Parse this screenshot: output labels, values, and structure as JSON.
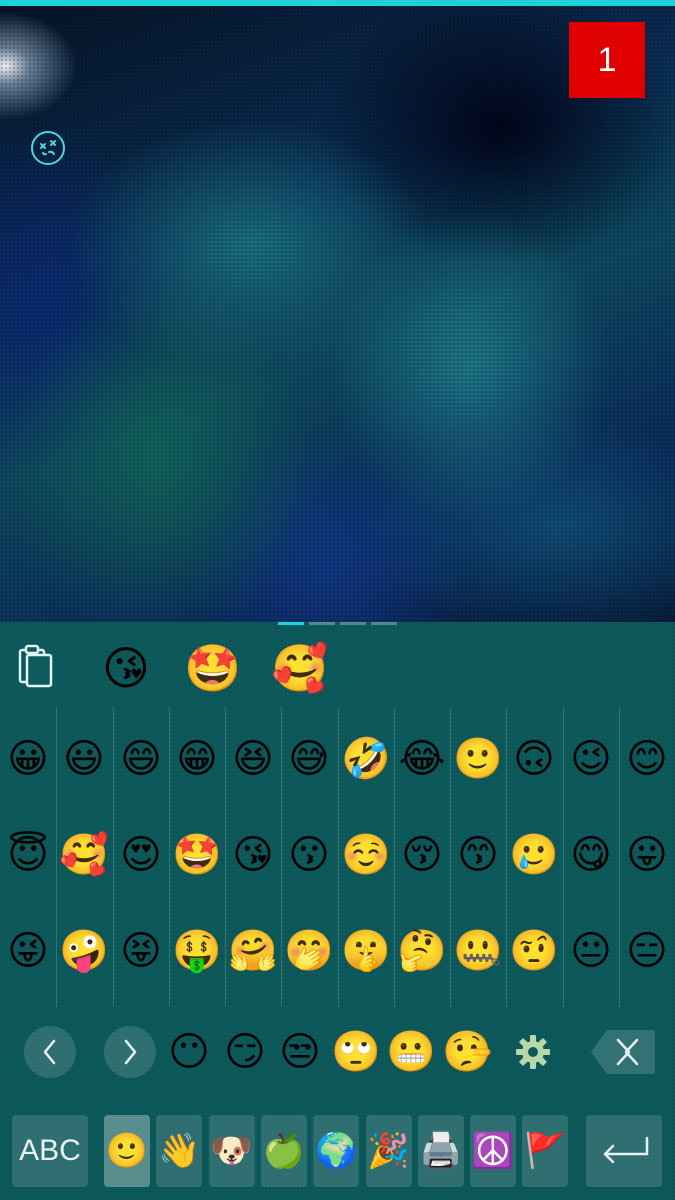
{
  "status": {
    "notification_count": "1"
  },
  "keyboard": {
    "recent_emojis": [
      "😘",
      "🤩",
      "🥰"
    ],
    "grid_rows": [
      [
        "😀",
        "😃",
        "😄",
        "😁",
        "😆",
        "😅",
        "🤣",
        "😂",
        "🙂",
        "🙃",
        "😉",
        "😊"
      ],
      [
        "😇",
        "🥰",
        "😍",
        "🤩",
        "😘",
        "😗",
        "☺️",
        "😚",
        "😙",
        "🥲",
        "😋",
        "😛"
      ],
      [
        "😜",
        "🤪",
        "😝",
        "🤑",
        "🤗",
        "🤭",
        "🤫",
        "🤔",
        "🤐",
        "🤨",
        "😐",
        "😑"
      ]
    ],
    "bottom_row_emojis": [
      "😶",
      "😏",
      "😒",
      "🙄",
      "😬",
      "🤥"
    ],
    "abc_label": "ABC",
    "category_tabs": [
      {
        "name": "smileys",
        "glyph": "🙂"
      },
      {
        "name": "people",
        "glyph": "👋"
      },
      {
        "name": "animals",
        "glyph": "🐶"
      },
      {
        "name": "food",
        "glyph": "🍏"
      },
      {
        "name": "travel",
        "glyph": "🌍"
      },
      {
        "name": "activities",
        "glyph": "🎉"
      },
      {
        "name": "objects",
        "glyph": "🖨️"
      },
      {
        "name": "symbols",
        "glyph": "☮️"
      },
      {
        "name": "flags",
        "glyph": "🚩"
      }
    ],
    "active_tab": "smileys",
    "page_count": 4,
    "current_page": 1,
    "colors": {
      "accent": "#1ed3d8",
      "badge": "#e00000",
      "keyboard_bg": "#0d5a5c"
    },
    "icons": {
      "clipboard": "clipboard-icon",
      "prev": "chevron-left-icon",
      "next": "chevron-right-icon",
      "settings": "gear-icon",
      "delete": "backspace-icon",
      "enter": "enter-icon"
    }
  }
}
